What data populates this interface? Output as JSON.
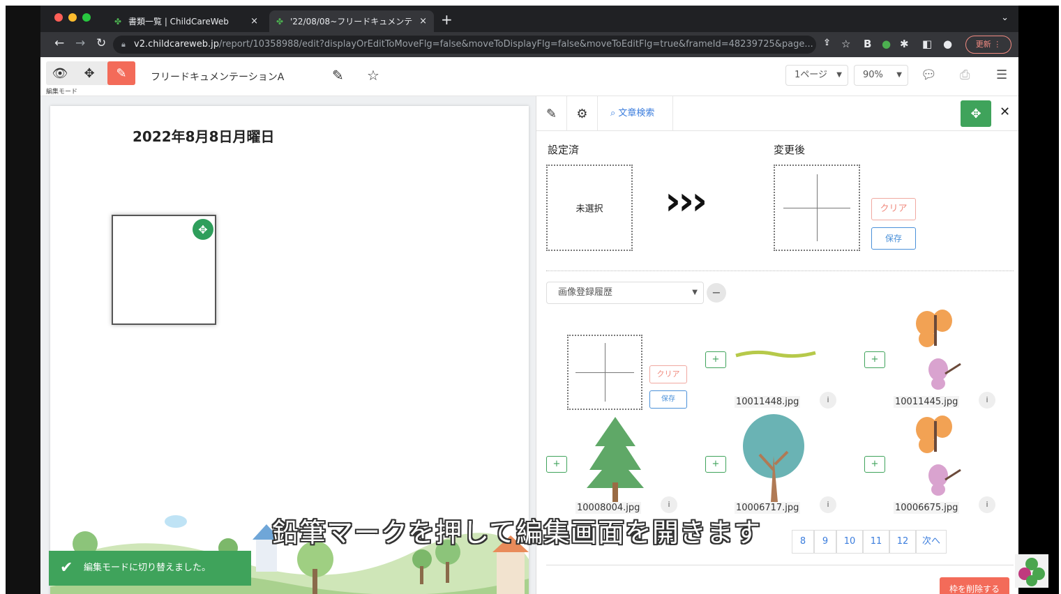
{
  "browser": {
    "tabs": [
      {
        "title": "書類一覧 | ChildCareWeb",
        "active": false
      },
      {
        "title": "'22/08/08~フリードキュメンテ",
        "active": true
      }
    ],
    "url_host": "v2.childcareweb.jp",
    "url_path": "/report/10358988/edit?displayOrEditToMoveFlg=false&moveToDisplayFlg=false&moveToEditFlg=true&frameId=48239725&page...",
    "ext_b": "B",
    "update_label": "更新"
  },
  "toolbar": {
    "mode_label": "編集モード",
    "document_title": "フリードキュメンテーションA",
    "page_select": "1ページ",
    "zoom_select": "90%"
  },
  "document": {
    "date": "2022年8月8日月曜日"
  },
  "toast": {
    "message": "編集モードに切り替えました。"
  },
  "panel": {
    "search_label": "文章検索",
    "current_label": "設定済",
    "current_value": "未選択",
    "arrows": "›››",
    "after_label": "変更後",
    "clear_label": "クリア",
    "save_label": "保存",
    "history_select": "画像登録履歴",
    "minus_label": "−",
    "add_label": "+",
    "info_label": "i",
    "images": [
      {
        "file": "10011448.jpg",
        "kind": "grass"
      },
      {
        "file": "10011445.jpg",
        "kind": "butterflies"
      },
      {
        "file": "10008004.jpg",
        "kind": "pine-tree"
      },
      {
        "file": "10006717.jpg",
        "kind": "round-tree"
      },
      {
        "file": "10006675.jpg",
        "kind": "butterflies"
      }
    ],
    "pages": [
      "8",
      "9",
      "10",
      "11",
      "12"
    ],
    "next_label": "次へ",
    "delete_label": "枠を削除する"
  },
  "subtitle": "鉛筆マークを押して編集画面を開きます",
  "colors": {
    "accent_green": "#3fa35b",
    "accent_red": "#f36b59",
    "link_blue": "#3b7ddd"
  }
}
